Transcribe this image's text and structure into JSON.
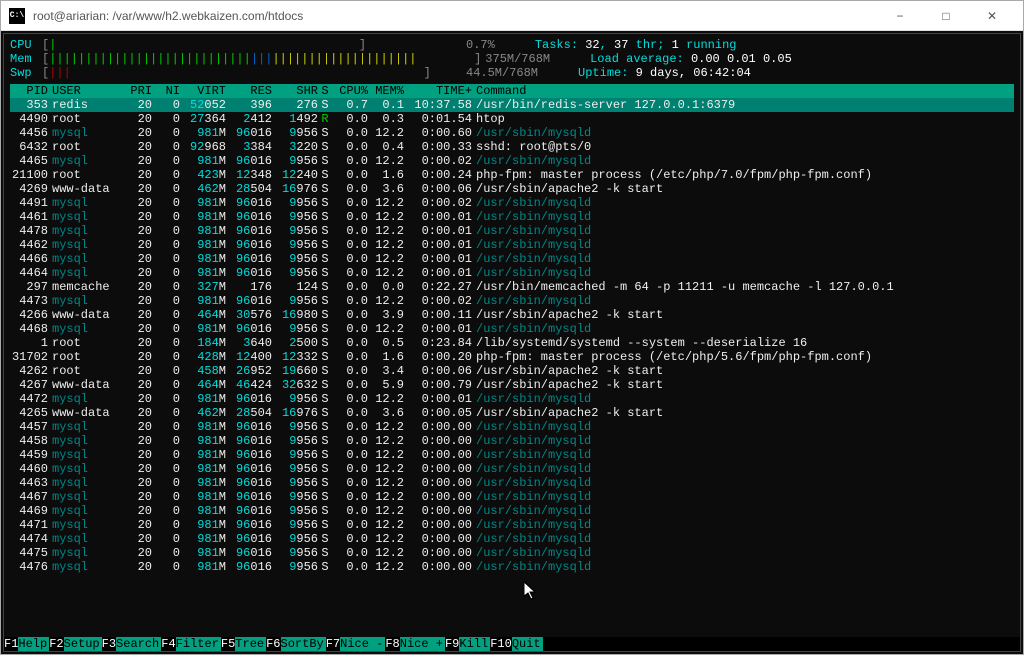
{
  "window": {
    "title": "root@ariarian: /var/www/h2.webkaizen.com/htdocs"
  },
  "meters": {
    "cpu": {
      "label": "CPU",
      "value": "0.7%"
    },
    "mem": {
      "label": "Mem",
      "value": "375M/768M"
    },
    "swp": {
      "label": "Swp",
      "value": "44.5M/768M"
    }
  },
  "summary": {
    "tasks_label": "Tasks:",
    "tasks_a": "32",
    "tasks_sep1": ",",
    "tasks_b": "37",
    "tasks_thr": " thr;",
    "tasks_c": "1",
    "tasks_run": "running",
    "load_label": "Load average:",
    "load1": "0.00",
    "load2": "0.01",
    "load3": "0.05",
    "uptime_label": "Uptime:",
    "uptime": "9 days, 06:42:04"
  },
  "headers": {
    "pid": "PID",
    "user": "USER",
    "pri": "PRI",
    "ni": "NI",
    "virt": "VIRT",
    "res": "RES",
    "shr": "SHR",
    "s": "S",
    "cpu": "CPU%",
    "mem": "MEM%",
    "time": "TIME+",
    "cmd": "Command"
  },
  "processes": [
    {
      "pid": "353",
      "user": "redis",
      "pri": "20",
      "ni": "0",
      "virt": "52052",
      "res": "396",
      "shr": "276",
      "s": "S",
      "cpu": "0.7",
      "mem": "0.1",
      "time": "10:37.58",
      "cmd": "/usr/bin/redis-server 127.0.0.1:6379",
      "hl": true,
      "dim": false
    },
    {
      "pid": "4490",
      "user": "root",
      "pri": "20",
      "ni": "0",
      "virt": "27364",
      "res": "2412",
      "shr": "1492",
      "s": "R",
      "cpu": "0.0",
      "mem": "0.3",
      "time": "0:01.54",
      "cmd": "htop",
      "dim": false,
      "green_s": true
    },
    {
      "pid": "4456",
      "user": "mysql",
      "pri": "20",
      "ni": "0",
      "virt": "981M",
      "res": "96016",
      "shr": "9956",
      "s": "S",
      "cpu": "0.0",
      "mem": "12.2",
      "time": "0:00.60",
      "cmd": "/usr/sbin/mysqld",
      "dim": true
    },
    {
      "pid": "6432",
      "user": "root",
      "pri": "20",
      "ni": "0",
      "virt": "92968",
      "res": "3384",
      "shr": "3220",
      "s": "S",
      "cpu": "0.0",
      "mem": "0.4",
      "time": "0:00.33",
      "cmd": "sshd: root@pts/0",
      "dim": false
    },
    {
      "pid": "4465",
      "user": "mysql",
      "pri": "20",
      "ni": "0",
      "virt": "981M",
      "res": "96016",
      "shr": "9956",
      "s": "S",
      "cpu": "0.0",
      "mem": "12.2",
      "time": "0:00.02",
      "cmd": "/usr/sbin/mysqld",
      "dim": true
    },
    {
      "pid": "21100",
      "user": "root",
      "pri": "20",
      "ni": "0",
      "virt": "423M",
      "res": "12348",
      "shr": "12240",
      "s": "S",
      "cpu": "0.0",
      "mem": "1.6",
      "time": "0:00.24",
      "cmd": "php-fpm: master process (/etc/php/7.0/fpm/php-fpm.conf)",
      "dim": false
    },
    {
      "pid": "4269",
      "user": "www-data",
      "pri": "20",
      "ni": "0",
      "virt": "462M",
      "res": "28504",
      "shr": "16976",
      "s": "S",
      "cpu": "0.0",
      "mem": "3.6",
      "time": "0:00.06",
      "cmd": "/usr/sbin/apache2 -k start",
      "dim": false
    },
    {
      "pid": "4491",
      "user": "mysql",
      "pri": "20",
      "ni": "0",
      "virt": "981M",
      "res": "96016",
      "shr": "9956",
      "s": "S",
      "cpu": "0.0",
      "mem": "12.2",
      "time": "0:00.02",
      "cmd": "/usr/sbin/mysqld",
      "dim": true
    },
    {
      "pid": "4461",
      "user": "mysql",
      "pri": "20",
      "ni": "0",
      "virt": "981M",
      "res": "96016",
      "shr": "9956",
      "s": "S",
      "cpu": "0.0",
      "mem": "12.2",
      "time": "0:00.01",
      "cmd": "/usr/sbin/mysqld",
      "dim": true
    },
    {
      "pid": "4478",
      "user": "mysql",
      "pri": "20",
      "ni": "0",
      "virt": "981M",
      "res": "96016",
      "shr": "9956",
      "s": "S",
      "cpu": "0.0",
      "mem": "12.2",
      "time": "0:00.01",
      "cmd": "/usr/sbin/mysqld",
      "dim": true
    },
    {
      "pid": "4462",
      "user": "mysql",
      "pri": "20",
      "ni": "0",
      "virt": "981M",
      "res": "96016",
      "shr": "9956",
      "s": "S",
      "cpu": "0.0",
      "mem": "12.2",
      "time": "0:00.01",
      "cmd": "/usr/sbin/mysqld",
      "dim": true
    },
    {
      "pid": "4466",
      "user": "mysql",
      "pri": "20",
      "ni": "0",
      "virt": "981M",
      "res": "96016",
      "shr": "9956",
      "s": "S",
      "cpu": "0.0",
      "mem": "12.2",
      "time": "0:00.01",
      "cmd": "/usr/sbin/mysqld",
      "dim": true
    },
    {
      "pid": "4464",
      "user": "mysql",
      "pri": "20",
      "ni": "0",
      "virt": "981M",
      "res": "96016",
      "shr": "9956",
      "s": "S",
      "cpu": "0.0",
      "mem": "12.2",
      "time": "0:00.01",
      "cmd": "/usr/sbin/mysqld",
      "dim": true
    },
    {
      "pid": "297",
      "user": "memcache",
      "pri": "20",
      "ni": "0",
      "virt": "327M",
      "res": "176",
      "shr": "124",
      "s": "S",
      "cpu": "0.0",
      "mem": "0.0",
      "time": "0:22.27",
      "cmd": "/usr/bin/memcached -m 64 -p 11211 -u memcache -l 127.0.0.1",
      "dim": false
    },
    {
      "pid": "4473",
      "user": "mysql",
      "pri": "20",
      "ni": "0",
      "virt": "981M",
      "res": "96016",
      "shr": "9956",
      "s": "S",
      "cpu": "0.0",
      "mem": "12.2",
      "time": "0:00.02",
      "cmd": "/usr/sbin/mysqld",
      "dim": true
    },
    {
      "pid": "4266",
      "user": "www-data",
      "pri": "20",
      "ni": "0",
      "virt": "464M",
      "res": "30576",
      "shr": "16980",
      "s": "S",
      "cpu": "0.0",
      "mem": "3.9",
      "time": "0:00.11",
      "cmd": "/usr/sbin/apache2 -k start",
      "dim": false
    },
    {
      "pid": "4468",
      "user": "mysql",
      "pri": "20",
      "ni": "0",
      "virt": "981M",
      "res": "96016",
      "shr": "9956",
      "s": "S",
      "cpu": "0.0",
      "mem": "12.2",
      "time": "0:00.01",
      "cmd": "/usr/sbin/mysqld",
      "dim": true
    },
    {
      "pid": "1",
      "user": "root",
      "pri": "20",
      "ni": "0",
      "virt": "184M",
      "res": "3640",
      "shr": "2500",
      "s": "S",
      "cpu": "0.0",
      "mem": "0.5",
      "time": "0:23.84",
      "cmd": "/lib/systemd/systemd --system --deserialize 16",
      "dim": false
    },
    {
      "pid": "31702",
      "user": "root",
      "pri": "20",
      "ni": "0",
      "virt": "428M",
      "res": "12400",
      "shr": "12332",
      "s": "S",
      "cpu": "0.0",
      "mem": "1.6",
      "time": "0:00.20",
      "cmd": "php-fpm: master process (/etc/php/5.6/fpm/php-fpm.conf)",
      "dim": false
    },
    {
      "pid": "4262",
      "user": "root",
      "pri": "20",
      "ni": "0",
      "virt": "458M",
      "res": "26952",
      "shr": "19660",
      "s": "S",
      "cpu": "0.0",
      "mem": "3.4",
      "time": "0:00.06",
      "cmd": "/usr/sbin/apache2 -k start",
      "dim": false
    },
    {
      "pid": "4267",
      "user": "www-data",
      "pri": "20",
      "ni": "0",
      "virt": "464M",
      "res": "46424",
      "shr": "32632",
      "s": "S",
      "cpu": "0.0",
      "mem": "5.9",
      "time": "0:00.79",
      "cmd": "/usr/sbin/apache2 -k start",
      "dim": false
    },
    {
      "pid": "4472",
      "user": "mysql",
      "pri": "20",
      "ni": "0",
      "virt": "981M",
      "res": "96016",
      "shr": "9956",
      "s": "S",
      "cpu": "0.0",
      "mem": "12.2",
      "time": "0:00.01",
      "cmd": "/usr/sbin/mysqld",
      "dim": true
    },
    {
      "pid": "4265",
      "user": "www-data",
      "pri": "20",
      "ni": "0",
      "virt": "462M",
      "res": "28504",
      "shr": "16976",
      "s": "S",
      "cpu": "0.0",
      "mem": "3.6",
      "time": "0:00.05",
      "cmd": "/usr/sbin/apache2 -k start",
      "dim": false
    },
    {
      "pid": "4457",
      "user": "mysql",
      "pri": "20",
      "ni": "0",
      "virt": "981M",
      "res": "96016",
      "shr": "9956",
      "s": "S",
      "cpu": "0.0",
      "mem": "12.2",
      "time": "0:00.00",
      "cmd": "/usr/sbin/mysqld",
      "dim": true
    },
    {
      "pid": "4458",
      "user": "mysql",
      "pri": "20",
      "ni": "0",
      "virt": "981M",
      "res": "96016",
      "shr": "9956",
      "s": "S",
      "cpu": "0.0",
      "mem": "12.2",
      "time": "0:00.00",
      "cmd": "/usr/sbin/mysqld",
      "dim": true
    },
    {
      "pid": "4459",
      "user": "mysql",
      "pri": "20",
      "ni": "0",
      "virt": "981M",
      "res": "96016",
      "shr": "9956",
      "s": "S",
      "cpu": "0.0",
      "mem": "12.2",
      "time": "0:00.00",
      "cmd": "/usr/sbin/mysqld",
      "dim": true
    },
    {
      "pid": "4460",
      "user": "mysql",
      "pri": "20",
      "ni": "0",
      "virt": "981M",
      "res": "96016",
      "shr": "9956",
      "s": "S",
      "cpu": "0.0",
      "mem": "12.2",
      "time": "0:00.00",
      "cmd": "/usr/sbin/mysqld",
      "dim": true
    },
    {
      "pid": "4463",
      "user": "mysql",
      "pri": "20",
      "ni": "0",
      "virt": "981M",
      "res": "96016",
      "shr": "9956",
      "s": "S",
      "cpu": "0.0",
      "mem": "12.2",
      "time": "0:00.00",
      "cmd": "/usr/sbin/mysqld",
      "dim": true
    },
    {
      "pid": "4467",
      "user": "mysql",
      "pri": "20",
      "ni": "0",
      "virt": "981M",
      "res": "96016",
      "shr": "9956",
      "s": "S",
      "cpu": "0.0",
      "mem": "12.2",
      "time": "0:00.00",
      "cmd": "/usr/sbin/mysqld",
      "dim": true
    },
    {
      "pid": "4469",
      "user": "mysql",
      "pri": "20",
      "ni": "0",
      "virt": "981M",
      "res": "96016",
      "shr": "9956",
      "s": "S",
      "cpu": "0.0",
      "mem": "12.2",
      "time": "0:00.00",
      "cmd": "/usr/sbin/mysqld",
      "dim": true
    },
    {
      "pid": "4471",
      "user": "mysql",
      "pri": "20",
      "ni": "0",
      "virt": "981M",
      "res": "96016",
      "shr": "9956",
      "s": "S",
      "cpu": "0.0",
      "mem": "12.2",
      "time": "0:00.00",
      "cmd": "/usr/sbin/mysqld",
      "dim": true
    },
    {
      "pid": "4474",
      "user": "mysql",
      "pri": "20",
      "ni": "0",
      "virt": "981M",
      "res": "96016",
      "shr": "9956",
      "s": "S",
      "cpu": "0.0",
      "mem": "12.2",
      "time": "0:00.00",
      "cmd": "/usr/sbin/mysqld",
      "dim": true
    },
    {
      "pid": "4475",
      "user": "mysql",
      "pri": "20",
      "ni": "0",
      "virt": "981M",
      "res": "96016",
      "shr": "9956",
      "s": "S",
      "cpu": "0.0",
      "mem": "12.2",
      "time": "0:00.00",
      "cmd": "/usr/sbin/mysqld",
      "dim": true
    },
    {
      "pid": "4476",
      "user": "mysql",
      "pri": "20",
      "ni": "0",
      "virt": "981M",
      "res": "96016",
      "shr": "9956",
      "s": "S",
      "cpu": "0.0",
      "mem": "12.2",
      "time": "0:00.00",
      "cmd": "/usr/sbin/mysqld",
      "dim": true
    }
  ],
  "fnkeys": [
    {
      "key": "F1",
      "label": "Help"
    },
    {
      "key": "F2",
      "label": "Setup"
    },
    {
      "key": "F3",
      "label": "Search"
    },
    {
      "key": "F4",
      "label": "Filter"
    },
    {
      "key": "F5",
      "label": "Tree"
    },
    {
      "key": "F6",
      "label": "SortBy"
    },
    {
      "key": "F7",
      "label": "Nice -"
    },
    {
      "key": "F8",
      "label": "Nice +"
    },
    {
      "key": "F9",
      "label": "Kill"
    },
    {
      "key": "F10",
      "label": "Quit"
    }
  ]
}
